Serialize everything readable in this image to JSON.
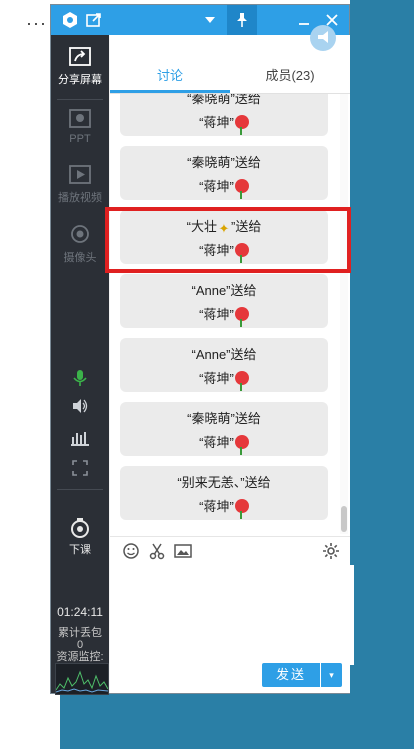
{
  "desktop": {
    "ellipsis": "···"
  },
  "titlebar": {
    "icons": [
      "app-logo-icon",
      "share-out-icon",
      "dropdown-arrow-icon",
      "pin-icon",
      "minimize-icon",
      "close-icon"
    ]
  },
  "sidebar": {
    "items": [
      {
        "label": "分享屏幕",
        "icon": "share-screen-icon",
        "active": true
      },
      {
        "label": "PPT",
        "icon": "ppt-icon"
      },
      {
        "label": "播放视频",
        "icon": "play-video-icon"
      },
      {
        "label": "摄像头",
        "icon": "camera-icon"
      }
    ],
    "controls": [
      "microphone-icon",
      "speaker-icon",
      "audio-level-icon",
      "fullscreen-icon"
    ],
    "end_class": {
      "label": "下课",
      "icon": "end-class-icon"
    },
    "timer": "01:24:11",
    "packet_loss_label": "累计丢包",
    "packet_loss_value": "0",
    "resource_monitor_label": "资源监控:"
  },
  "tabs": [
    {
      "label": "讨论",
      "active": true
    },
    {
      "label": "成员(23)",
      "active": false
    }
  ],
  "messages": [
    {
      "line1": "“秦晓萌”送给",
      "line2": "“蒋坤”",
      "gift": "rose"
    },
    {
      "line1": "“秦晓萌”送给",
      "line2": "“蒋坤”",
      "gift": "rose"
    },
    {
      "line1_a": "“大壮",
      "line1_b": "”送给",
      "line2": "“蒋坤”",
      "gift": "rose"
    },
    {
      "line1": "“Anne”送给",
      "line2": "“蒋坤”",
      "gift": "rose"
    },
    {
      "line1": "“Anne”送给",
      "line2": "“蒋坤”",
      "gift": "rose"
    },
    {
      "line1": "“秦晓萌”送给",
      "line2": "“蒋坤”",
      "gift": "rose"
    },
    {
      "line1": "“别来无恙、”送给",
      "line2": "“蒋坤”",
      "gift": "rose"
    }
  ],
  "composer": {
    "tools": [
      "emoji-icon",
      "scissors-icon",
      "image-icon",
      "settings-icon"
    ],
    "input_value": "",
    "send_label": "发送",
    "send_dropdown": "▾"
  },
  "colors": {
    "accent": "#2e9fe6",
    "highlight_box": "#e02020",
    "sidebar": "#2b2f36"
  }
}
